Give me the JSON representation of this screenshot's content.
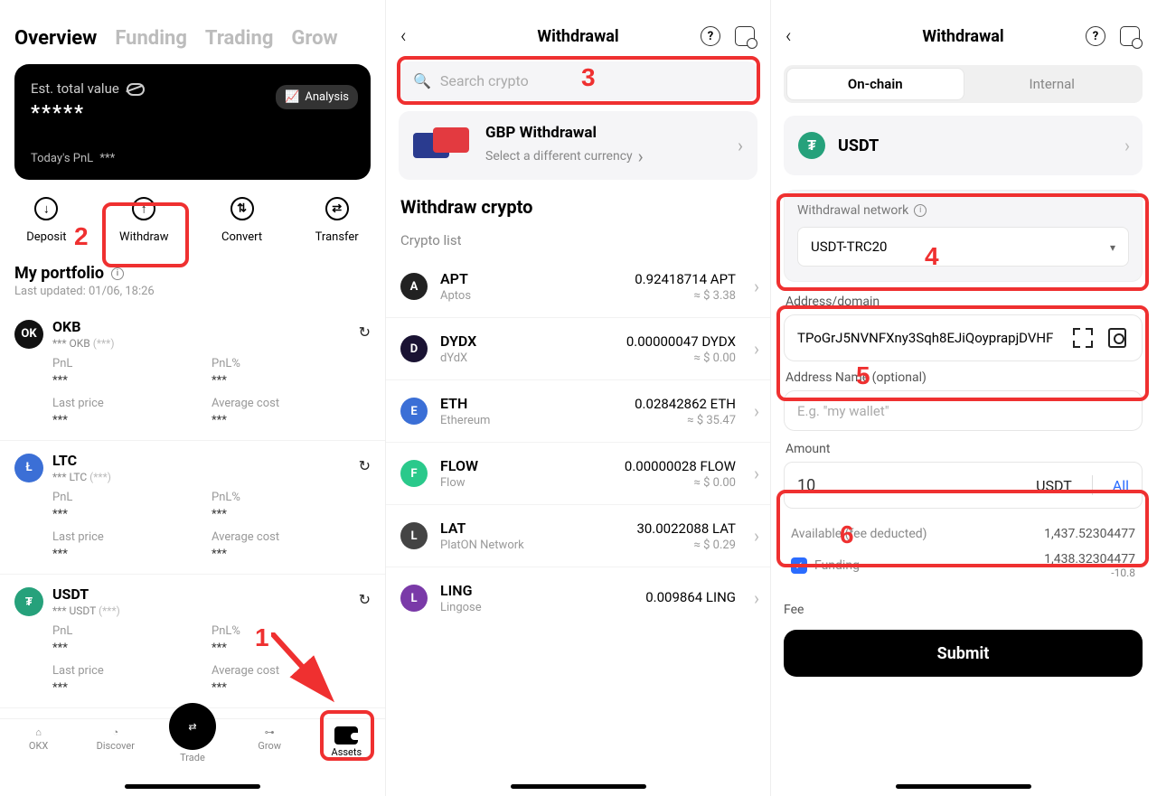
{
  "annotations": {
    "1": "1",
    "2": "2",
    "3": "3",
    "4": "4",
    "5": "5",
    "6": "6"
  },
  "screen1": {
    "tabs": {
      "overview": "Overview",
      "funding": "Funding",
      "trading": "Trading",
      "grow": "Grow"
    },
    "est_label": "Est. total value",
    "masked_value": "*****",
    "analysis": "Analysis",
    "todays_pnl_label": "Today's PnL",
    "todays_pnl_value": "***",
    "actions": {
      "deposit": "Deposit",
      "withdraw": "Withdraw",
      "convert": "Convert",
      "transfer": "Transfer"
    },
    "portfolio_title": "My portfolio",
    "last_updated": "Last updated: 01/06, 18:26",
    "row_labels": {
      "pnl": "PnL",
      "pnlp": "PnL%",
      "last": "Last price",
      "avg": "Average cost"
    },
    "star": "***",
    "items": [
      {
        "sym": "OKB",
        "sub_prefix": "*** OKB",
        "sub_paren": "(***)",
        "icon_bg": "#111",
        "icon_txt": "OK"
      },
      {
        "sym": "LTC",
        "sub_prefix": "*** LTC",
        "sub_paren": "(***)",
        "icon_bg": "#3b6fd6",
        "icon_txt": "Ł"
      },
      {
        "sym": "USDT",
        "sub_prefix": "*** USDT",
        "sub_paren": "(***)",
        "icon_bg": "#26a17b",
        "icon_txt": "₮"
      }
    ],
    "tabbar": {
      "okx": "OKX",
      "discover": "Discover",
      "trade": "Trade",
      "grow": "Grow",
      "assets": "Assets"
    }
  },
  "screen2": {
    "title": "Withdrawal",
    "search_placeholder": "Search crypto",
    "fiat": {
      "title": "GBP Withdrawal",
      "subtitle": "Select a different currency"
    },
    "withdraw_title": "Withdraw crypto",
    "list_label": "Crypto list",
    "items": [
      {
        "sym": "APT",
        "name": "Aptos",
        "amt": "0.92418714 APT",
        "fiat": "≈ $ 3.38",
        "bg": "#222"
      },
      {
        "sym": "DYDX",
        "name": "dYdX",
        "amt": "0.00000047 DYDX",
        "fiat": "≈ $ 0.00",
        "bg": "#1a1333"
      },
      {
        "sym": "ETH",
        "name": "Ethereum",
        "amt": "0.02842862 ETH",
        "fiat": "≈ $ 35.47",
        "bg": "#3b6fd6"
      },
      {
        "sym": "FLOW",
        "name": "Flow",
        "amt": "0.00000028 FLOW",
        "fiat": "≈ $ 0.00",
        "bg": "#2ac98b"
      },
      {
        "sym": "LAT",
        "name": "PlatON Network",
        "amt": "30.0022088 LAT",
        "fiat": "≈ $ 0.29",
        "bg": "#444"
      },
      {
        "sym": "LING",
        "name": "Lingose",
        "amt": "0.009864 LING",
        "fiat": "",
        "bg": "#7a3aa8"
      }
    ]
  },
  "screen3": {
    "title": "Withdrawal",
    "seg": {
      "onchain": "On-chain",
      "internal": "Internal"
    },
    "token": "USDT",
    "network_label": "Withdrawal network",
    "network_value": "USDT-TRC20",
    "address_label": "Address/domain",
    "address_value": "TPoGrJ5NVNFXny3Sqh8EJiQoyprapjDVHF",
    "addrname_label": "Address Name (optional)",
    "addrname_placeholder": "E.g. \"my wallet\"",
    "amount_label": "Amount",
    "amount_value": "10",
    "amount_unit": "USDT",
    "amount_all": "All",
    "avail_label": "Available (fee deducted)",
    "avail_value": "1,437.52304477",
    "funding_label": "Funding",
    "funding_value": "1,438.32304477",
    "funding_delta": "-10.8",
    "fee_label": "Fee",
    "submit": "Submit"
  }
}
